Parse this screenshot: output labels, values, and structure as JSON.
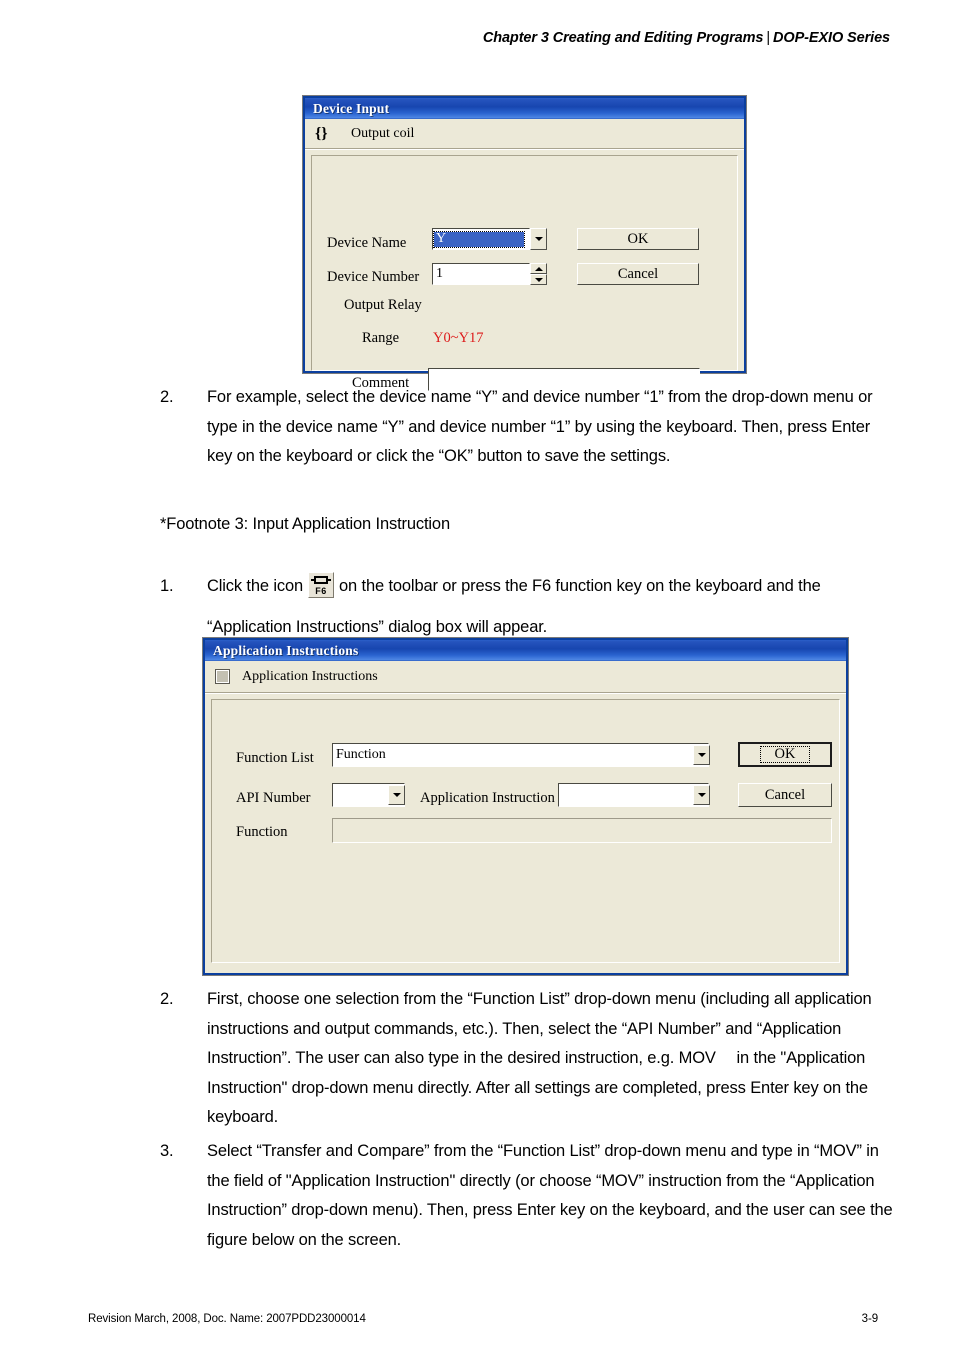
{
  "header": {
    "chapter": "Chapter 3 Creating and Editing Programs",
    "separator": "|",
    "series": "DOP-EXIO Series"
  },
  "footer": {
    "revision": "Revision March, 2008, Doc. Name: 2007PDD23000014",
    "page_number": "3-9"
  },
  "device_input_dialog": {
    "title": "Device Input",
    "symbol": "{ }",
    "subtitle": "Output coil",
    "labels": {
      "device_name": "Device Name",
      "device_number": "Device Number",
      "output_relay": "Output Relay",
      "range": "Range",
      "comment": "Comment"
    },
    "values": {
      "device_name": "Y",
      "device_number": "1",
      "range": "Y0~Y17",
      "comment": ""
    },
    "buttons": {
      "ok": "OK",
      "cancel": "Cancel"
    },
    "colors": {
      "range_text": "#dd1a1a",
      "selection": "#3a63c4",
      "titlebar": "#1746b0",
      "dialog_face": "#ece9d8"
    }
  },
  "body": {
    "step_device_2": {
      "num": "2.",
      "text": "For example, select the device name “Y” and device number “1” from the drop-down menu or type in the device name “Y” and device number “1” by using the keyboard. Then, press Enter key on the keyboard or click the “OK” button to save the settings."
    },
    "footnote": "*Footnote 3: Input Application Instruction",
    "step_app_1": {
      "num": "1.",
      "text_before": "Click the icon",
      "icon_label": "F6",
      "text_after": "on the toolbar or press the F6 function key on the keyboard and the “Application Instructions” dialog box will appear."
    },
    "step_app_2": {
      "num": "2.",
      "text": "First, choose one selection from the “Function List” drop-down menu (including all application instructions and output commands, etc.). Then, select the “API Number” and “Application Instruction”. The user can also type in the desired instruction, e.g. MOV  in the \"Application Instruction\" drop-down menu directly. After all settings are completed, press Enter key on the keyboard."
    },
    "step_app_3": {
      "num": "3.",
      "text": "Select “Transfer and Compare” from the “Function List” drop-down menu and type in “MOV” in the field of \"Application Instruction\" directly (or choose “MOV” instruction from the “Application Instruction” drop-down menu). Then, press Enter key on the keyboard, and the user can see the figure below on the screen."
    }
  },
  "application_instructions_dialog": {
    "title": "Application Instructions",
    "subtitle": "Application Instructions",
    "labels": {
      "function_list": "Function List",
      "api_number": "API Number",
      "application_instruction": "Application Instruction",
      "function": "Function"
    },
    "values": {
      "function_list": "Function",
      "api_number": "",
      "application_instruction": "",
      "function": ""
    },
    "buttons": {
      "ok": "OK",
      "cancel": "Cancel"
    }
  }
}
